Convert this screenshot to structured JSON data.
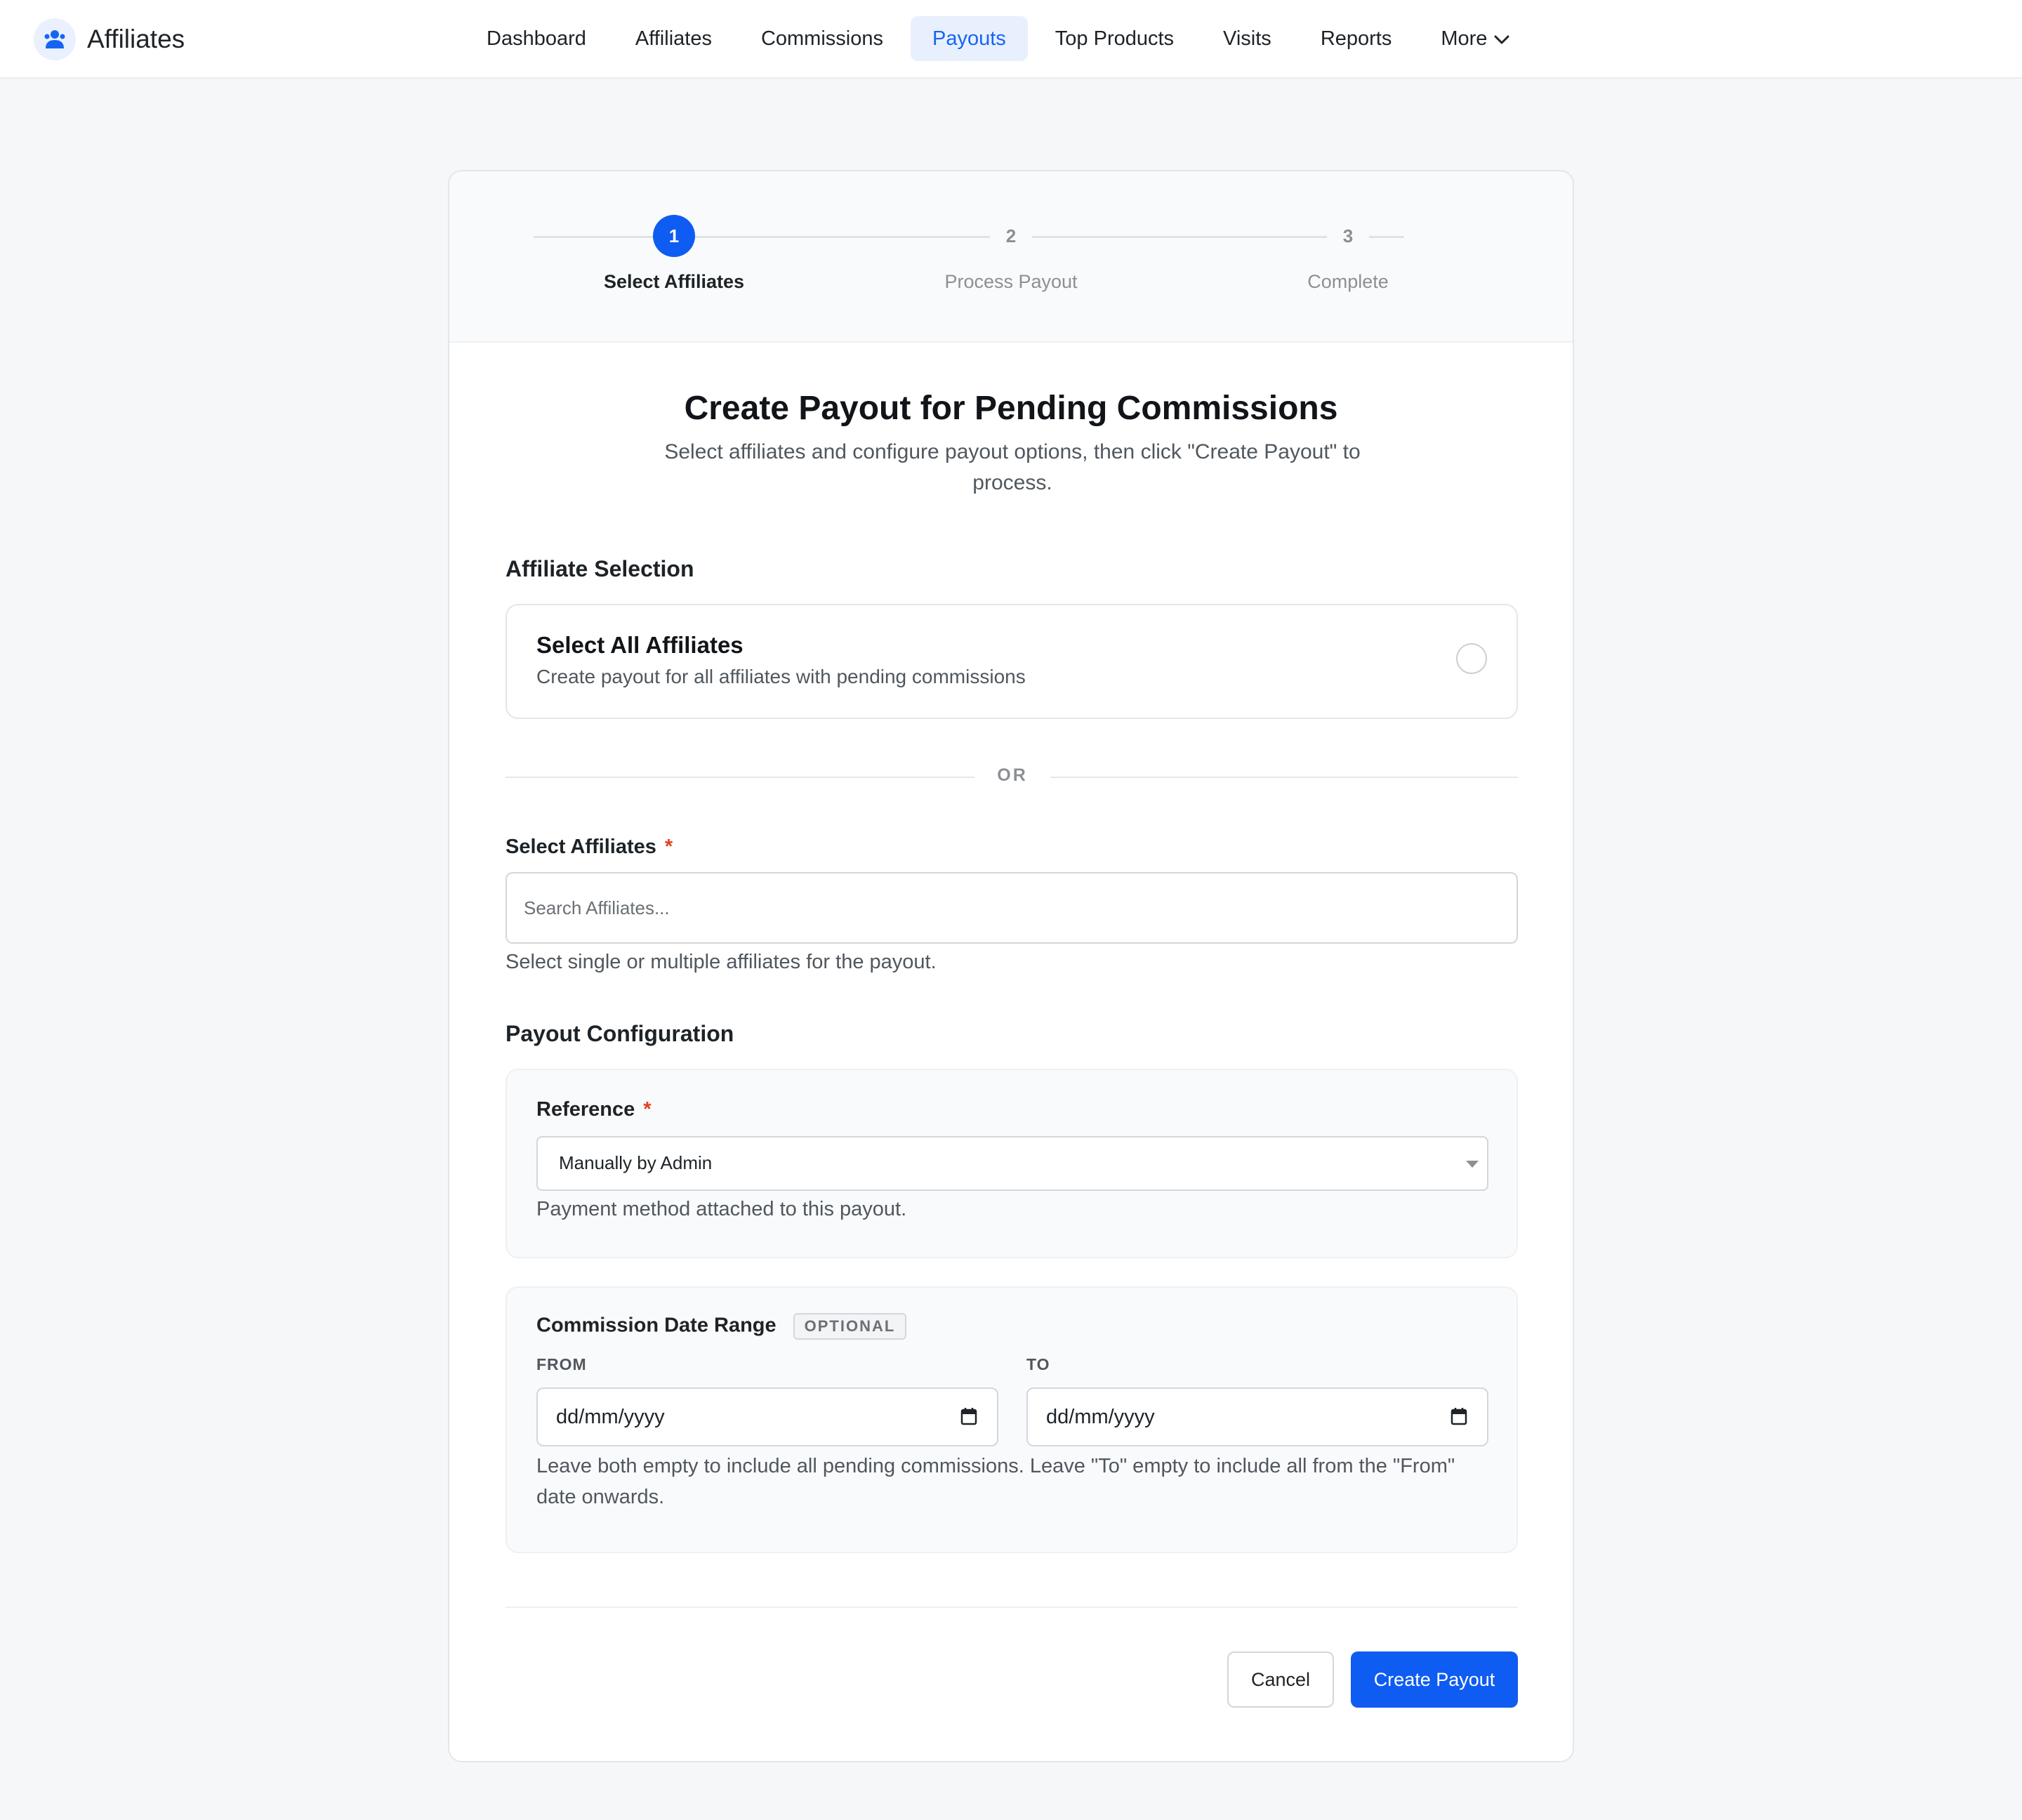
{
  "app": {
    "name": "Affiliates",
    "logo_icon": "affiliates-logo-icon"
  },
  "nav": {
    "items": [
      {
        "label": "Dashboard",
        "active": false
      },
      {
        "label": "Affiliates",
        "active": false
      },
      {
        "label": "Commissions",
        "active": false
      },
      {
        "label": "Payouts",
        "active": true
      },
      {
        "label": "Top Products",
        "active": false
      },
      {
        "label": "Visits",
        "active": false
      },
      {
        "label": "Reports",
        "active": false
      },
      {
        "label": "More",
        "active": false
      }
    ]
  },
  "stepper": {
    "steps": [
      {
        "number": "1",
        "label": "Select Affiliates",
        "state": "active"
      },
      {
        "number": "2",
        "label": "Process Payout",
        "state": "inactive"
      },
      {
        "number": "3",
        "label": "Complete",
        "state": "inactive"
      }
    ]
  },
  "main": {
    "title": "Create Payout for Pending Commissions",
    "description": "Select affiliates and configure payout options, then click \"Create Payout\" to process."
  },
  "affiliate_selection": {
    "section_title": "Affiliate Selection",
    "select_all_title": "Select All Affiliates",
    "select_all_desc": "Create payout for all affiliates with pending commissions",
    "select_all_checked": false,
    "or_label": "OR",
    "select_label": "Select Affiliates",
    "required_mark": "*",
    "search_placeholder": "Search Affiliates...",
    "search_value": "",
    "help": "Select single or multiple affiliates for the payout."
  },
  "payout_config": {
    "section_title": "Payout Configuration",
    "reference_label": "Reference",
    "required_mark": "*",
    "reference_value": "Manually by Admin",
    "reference_help": "Payment method attached to this payout.",
    "date_range_label": "Commission Date Range",
    "optional_badge": "OPTIONAL",
    "from_label": "FROM",
    "to_label": "TO",
    "from_placeholder": "dd/mm/yyyy",
    "to_placeholder": "dd/mm/yyyy",
    "date_help": "Leave both empty to include all pending commissions. Leave \"To\" empty to include all from the \"From\" date onwards."
  },
  "actions": {
    "cancel": "Cancel",
    "create": "Create Payout"
  },
  "colors": {
    "primary": "#0f5cf2",
    "required": "#e2401c",
    "nav_active_bg": "#e9f0fd"
  }
}
